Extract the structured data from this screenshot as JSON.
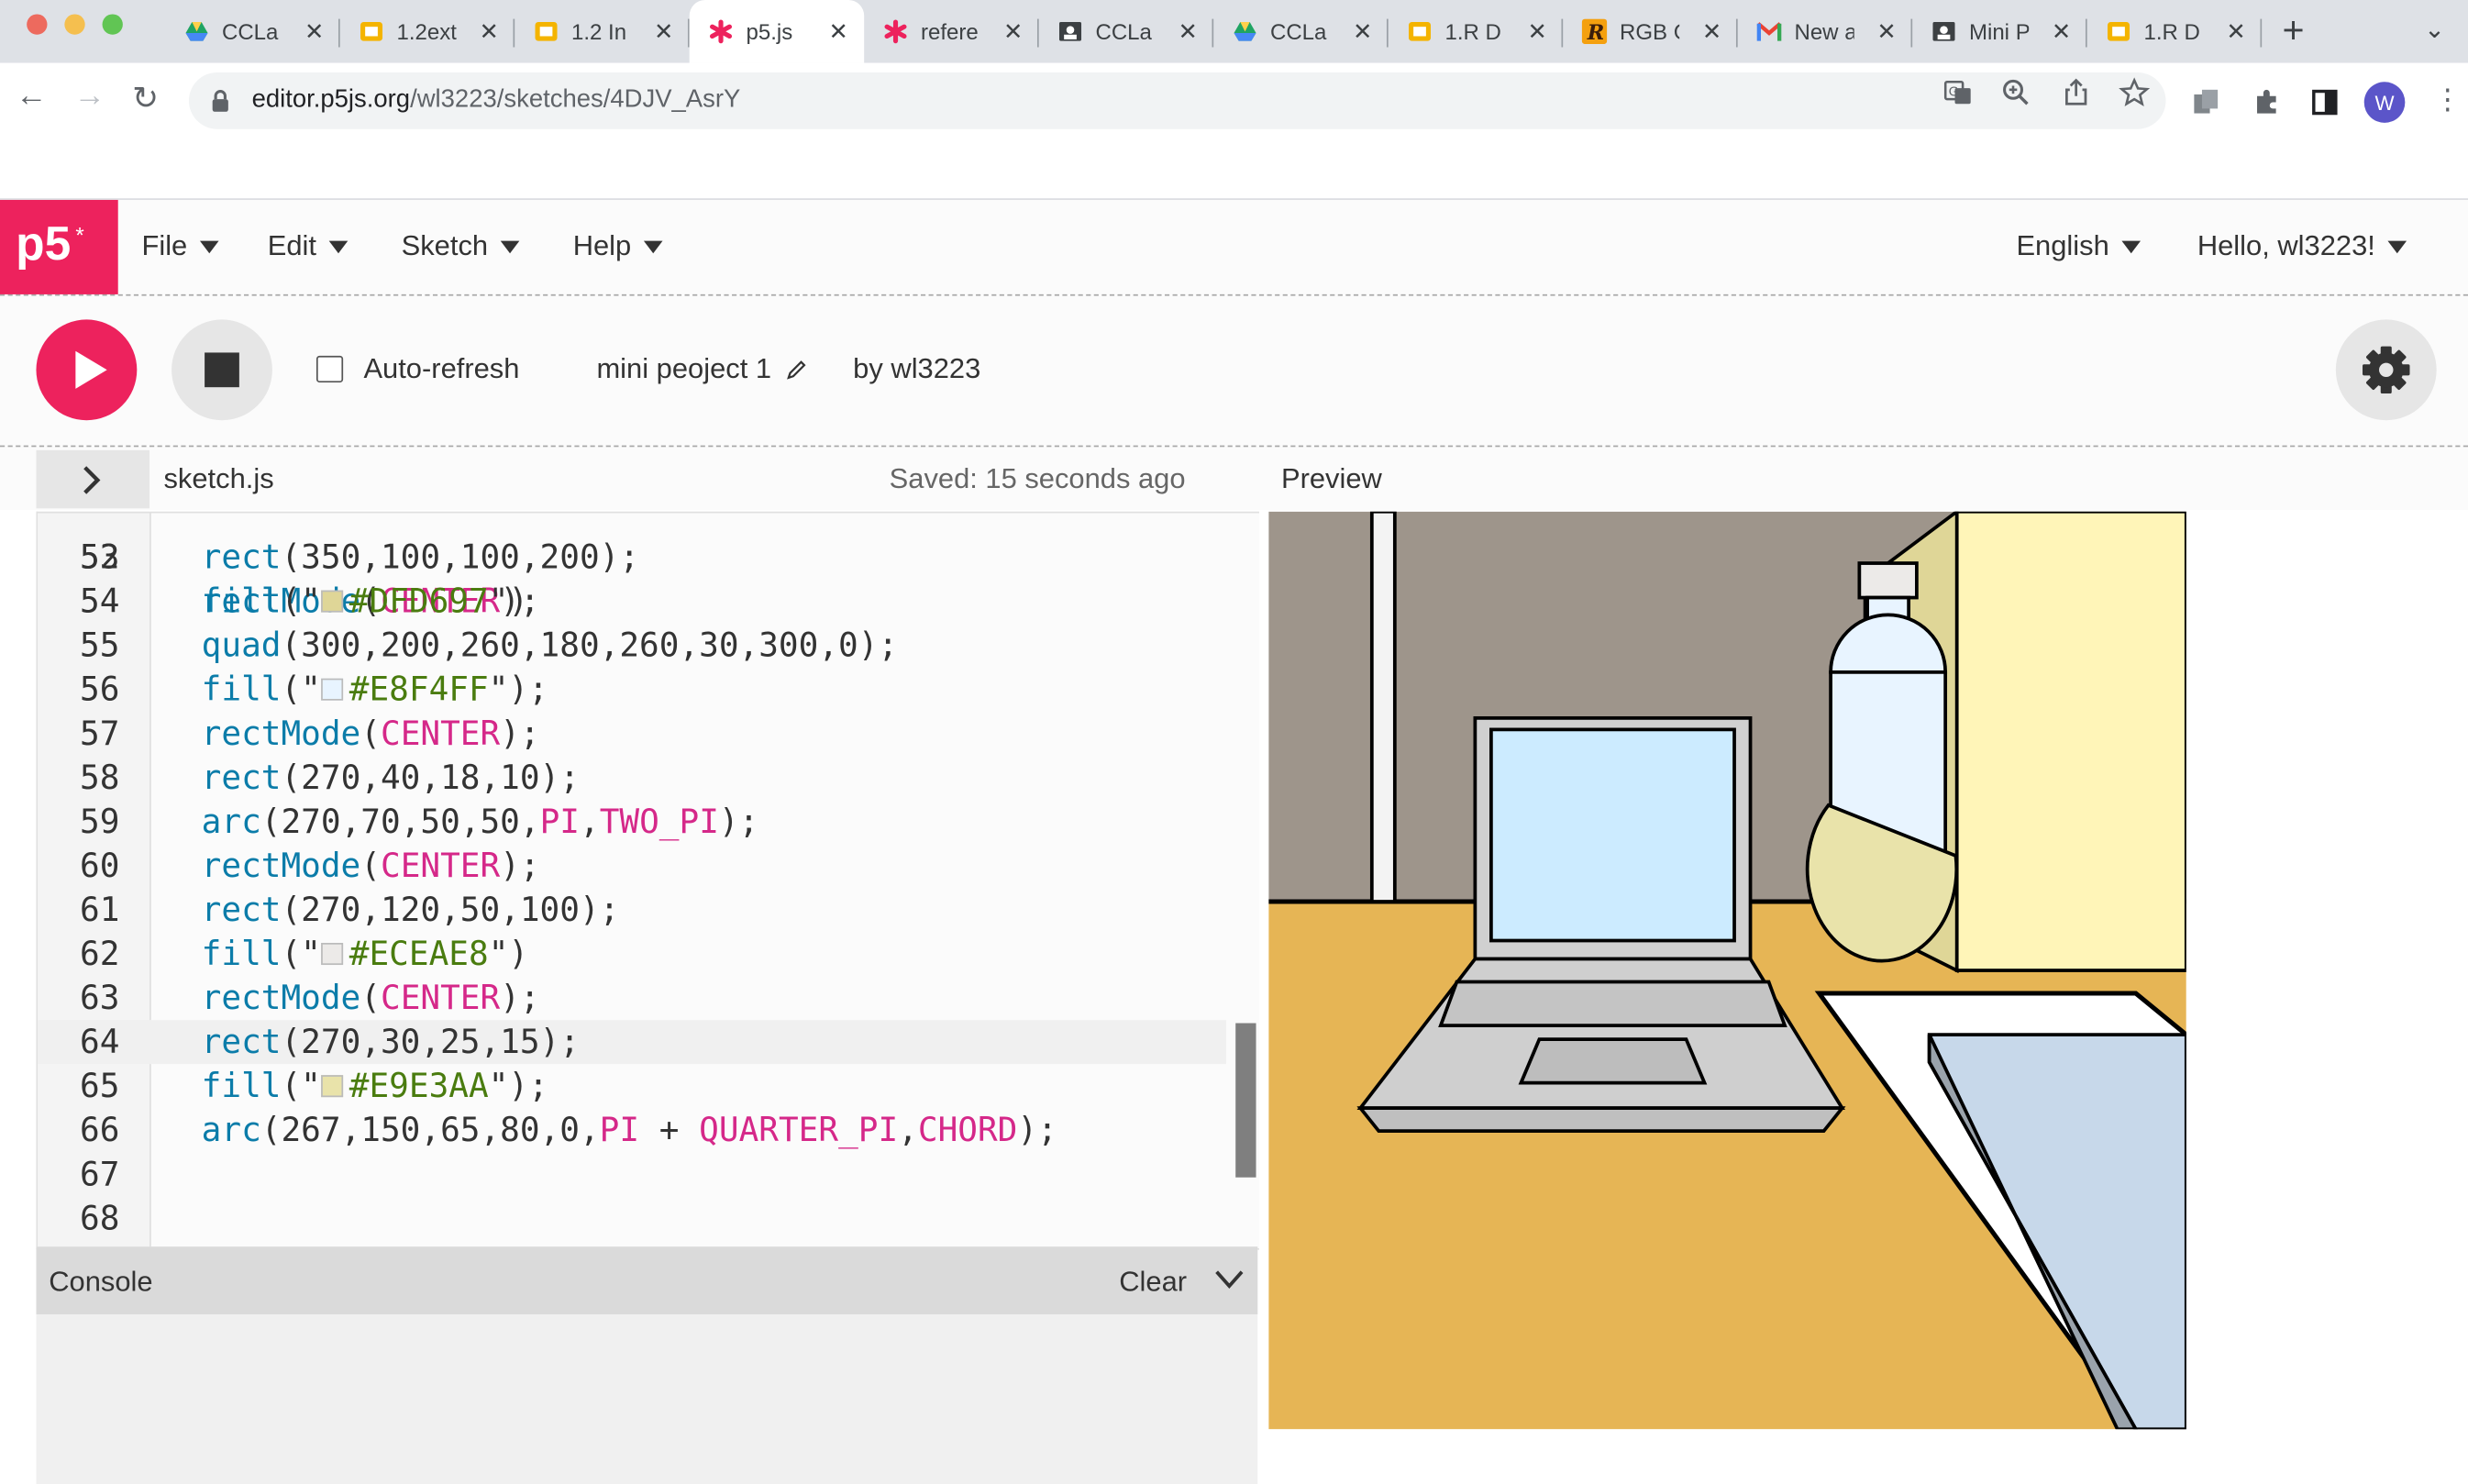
{
  "browser": {
    "tabs": [
      {
        "label": "CCLa",
        "icon": "google-drive-icon"
      },
      {
        "label": "1.2ext",
        "icon": "slides-icon"
      },
      {
        "label": "1.2 In",
        "icon": "slides-icon"
      },
      {
        "label": "p5.js",
        "icon": "p5-asterisk-icon",
        "active": true
      },
      {
        "label": "refere",
        "icon": "p5-asterisk-icon"
      },
      {
        "label": "CCLa",
        "icon": "classroom-icon"
      },
      {
        "label": "CCLa",
        "icon": "google-drive-icon"
      },
      {
        "label": "1.R D",
        "icon": "slides-icon"
      },
      {
        "label": "RGB C",
        "icon": "r-logo-icon"
      },
      {
        "label": "New a",
        "icon": "gmail-icon"
      },
      {
        "label": "Mini P",
        "icon": "classroom-icon"
      },
      {
        "label": "1.R D",
        "icon": "slides-icon"
      }
    ],
    "url_host": "editor.p5js.org",
    "url_path": "/wl3223/sketches/4DJV_AsrY",
    "profile_initial": "W"
  },
  "editor_nav": {
    "logo": "p5",
    "menus": [
      "File",
      "Edit",
      "Sketch",
      "Help"
    ],
    "language": "English",
    "greeting": "Hello, wl3223!"
  },
  "toolbar": {
    "auto_refresh_label": "Auto-refresh",
    "auto_refresh_checked": false,
    "sketch_name": "mini peoject 1",
    "author": "by wl3223"
  },
  "file_bar": {
    "filename": "sketch.js",
    "saved_status": "Saved: 15 seconds ago",
    "preview_label": "Preview"
  },
  "code": {
    "first_partial_line": "52",
    "lines": [
      {
        "n": "53",
        "text": "rect(350,100,100,200);"
      },
      {
        "n": "54",
        "text": "fill(\"#DFD697\")"
      },
      {
        "n": "55",
        "text": "quad(300,200,260,180,260,30,300,0);"
      },
      {
        "n": "56",
        "text": "fill(\"#E8F4FF\");"
      },
      {
        "n": "57",
        "text": "rectMode(CENTER);"
      },
      {
        "n": "58",
        "text": "rect(270,40,18,10);"
      },
      {
        "n": "59",
        "text": "arc(270,70,50,50,PI,TWO_PI);"
      },
      {
        "n": "60",
        "text": "rectMode(CENTER);"
      },
      {
        "n": "61",
        "text": "rect(270,120,50,100);"
      },
      {
        "n": "62",
        "text": "fill(\"#ECEAE8\")"
      },
      {
        "n": "63",
        "text": "rectMode(CENTER);"
      },
      {
        "n": "64",
        "text": "rect(270,30,25,15);"
      },
      {
        "n": "65",
        "text": "fill(\"#E9E3AA\");"
      },
      {
        "n": "66",
        "text": "arc(267,150,65,80,0,PI + QUARTER_PI,CHORD);"
      },
      {
        "n": "67",
        "text": ""
      },
      {
        "n": "68",
        "text": ""
      }
    ],
    "highlighted_line": "64"
  },
  "console": {
    "title": "Console",
    "clear_label": "Clear"
  },
  "colors": {
    "p5_pink": "#ED225D",
    "wall": "#9E958B",
    "desk": "#E6B555",
    "screen": "#CCEBFF",
    "laptop": "#CFCFCF",
    "cabinet": "#FFF5B8",
    "bottle": "#E8F4FF",
    "bottle_cap": "#ECEAE8",
    "orange_slice": "#E9E3AA",
    "book": "#C7D8EA"
  }
}
